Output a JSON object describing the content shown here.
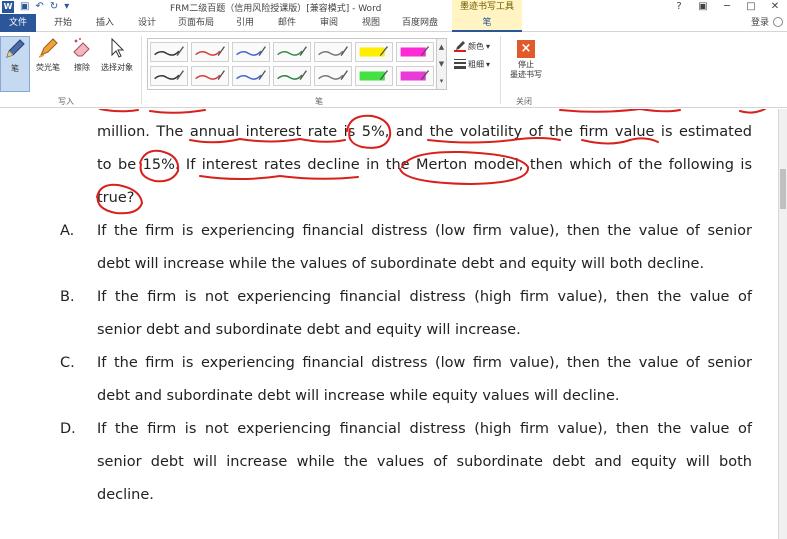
{
  "titlebar": {
    "doc_title": "FRM二级百题（信用风险授课版）[兼容模式] - Word",
    "context_tool": "墨迹书写工具",
    "win_controls": [
      "?",
      "▣",
      "─",
      "□",
      "✕"
    ]
  },
  "tabs": {
    "file": "文件",
    "items": [
      "开始",
      "插入",
      "设计",
      "页面布局",
      "引用",
      "邮件",
      "审阅",
      "视图",
      "百度网盘"
    ],
    "pen": "笔",
    "login": "登录"
  },
  "ribbon": {
    "write_group": {
      "label": "写入",
      "pen": "笔",
      "highlighter": "荧光笔",
      "eraser": "擦除",
      "select": "选择对象"
    },
    "pens_group": {
      "label": "笔",
      "color": "颜色",
      "weight": "粗细"
    },
    "close_group": {
      "label": "关闭",
      "stop_line1": "停止",
      "stop_line2": "墨迹书写"
    },
    "pen_colors_row1": [
      "#333333",
      "#d23b3b",
      "#4466c8",
      "#3a8a4a",
      "#777777",
      "#ffee00",
      "#ff2ad4"
    ],
    "pen_colors_row2": [
      "#333333",
      "#d23b3b",
      "#4466c8",
      "#2f8040",
      "#777777",
      "#44e044",
      "#e83bd8"
    ]
  },
  "document": {
    "question_lines": [
      "million. The annual interest rate is 5%, and the volatility of the firm value is estimated",
      "to be 15%. If interest rates decline in the Merton model, then which of the following is",
      "true?"
    ],
    "options": [
      {
        "letter": "A.",
        "lines": [
          "If the firm is experiencing financial distress (low firm value), then the value of senior",
          "debt will increase while the values of subordinate debt and equity will both decline."
        ]
      },
      {
        "letter": "B.",
        "lines": [
          "If the firm is not experiencing financial distress (high firm value), then the value of",
          "senior debt and subordinate debt and equity will increase."
        ]
      },
      {
        "letter": "C.",
        "lines": [
          "If the firm is experiencing financial distress (low firm value), then the value of senior",
          "debt and subordinate debt will increase while equity values will decline."
        ]
      },
      {
        "letter": "D.",
        "lines": [
          "If the firm is not experiencing financial distress (high firm value), then the value of",
          "senior debt will increase while the values of subordinate debt and equity will both",
          "decline."
        ]
      }
    ],
    "ink_color": "#d8201c"
  }
}
